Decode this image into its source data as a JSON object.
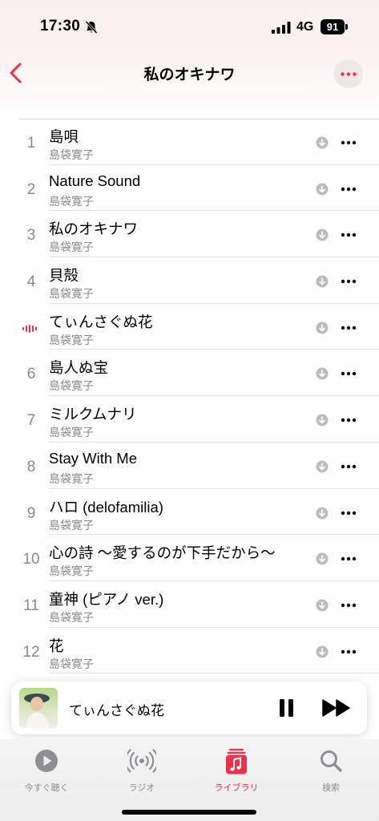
{
  "status_bar": {
    "time": "17:30",
    "network": "4G",
    "battery": "91"
  },
  "nav": {
    "title": "私のオキナワ"
  },
  "tracks": [
    {
      "num": "1",
      "title": "島唄",
      "artist": "島袋寛子"
    },
    {
      "num": "2",
      "title": "Nature Sound",
      "artist": "島袋寛子"
    },
    {
      "num": "3",
      "title": "私のオキナワ",
      "artist": "島袋寛子"
    },
    {
      "num": "4",
      "title": "貝殻",
      "artist": "島袋寛子"
    },
    {
      "num": "",
      "title": "てぃんさぐぬ花",
      "artist": "島袋寛子",
      "playing": true
    },
    {
      "num": "6",
      "title": "島人ぬ宝",
      "artist": "島袋寛子"
    },
    {
      "num": "7",
      "title": "ミルクムナリ",
      "artist": "島袋寛子"
    },
    {
      "num": "8",
      "title": "Stay With Me",
      "artist": "島袋寛子"
    },
    {
      "num": "9",
      "title": "ハロ (delofamilia)",
      "artist": "島袋寛子"
    },
    {
      "num": "10",
      "title": "心の詩 〜愛するのが下手だから〜",
      "artist": "島袋寛子"
    },
    {
      "num": "11",
      "title": "童神 (ピアノ ver.)",
      "artist": "島袋寛子"
    },
    {
      "num": "12",
      "title": "花",
      "artist": "島袋寛子"
    }
  ],
  "now_playing": {
    "title": "てぃんさぐぬ花",
    "state": "playing"
  },
  "tabs": [
    {
      "id": "listen-now",
      "label": "今すぐ聴く",
      "icon": "play-circle-icon"
    },
    {
      "id": "radio",
      "label": "ラジオ",
      "icon": "radio-broadcast-icon"
    },
    {
      "id": "library",
      "label": "ライブラリ",
      "icon": "music-library-icon",
      "active": true
    },
    {
      "id": "search",
      "label": "検索",
      "icon": "search-icon"
    }
  ],
  "colors": {
    "accent": "#f0304b",
    "secondary_text": "#8a8a8e",
    "tab_inactive": "#8e8e93"
  }
}
